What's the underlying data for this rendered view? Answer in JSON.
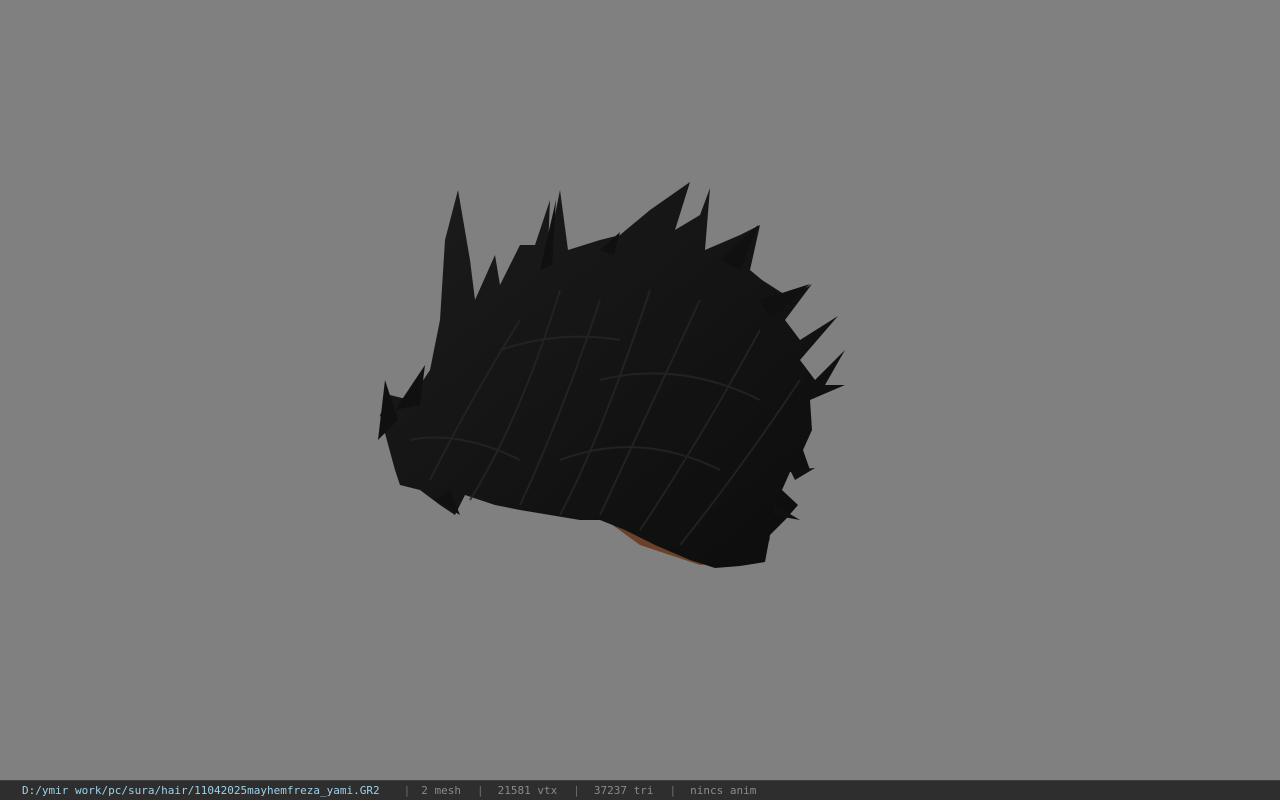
{
  "status_bar": {
    "file_path": "D:/ymir work/pc/sura/hair/11042025mayhemfreza_yami.GR2",
    "separator": "|",
    "mesh": "2 mesh",
    "vertices": "21581 vtx",
    "triangles": "37237 tri",
    "animation": "nincs anim"
  },
  "colors": {
    "background": "#808080",
    "status_bar_background": "#2e2e2e",
    "path_text": "#9ed0e6",
    "stat_text": "#8a8a8a",
    "hair": "#141414",
    "skin": "#6b4128"
  }
}
